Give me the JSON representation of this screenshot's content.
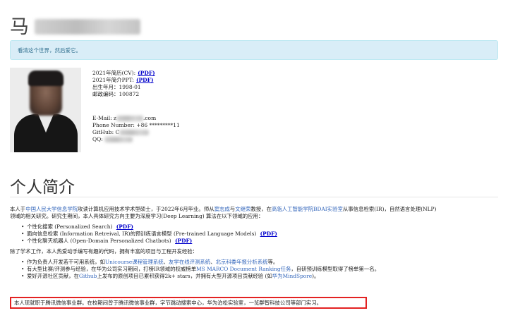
{
  "header": {
    "name_visible": "马"
  },
  "motto": "看清这个世界，然后爱它。",
  "profile": {
    "cv_label": "2021年简历(CV):",
    "ppt_label": "2021年简介PPT:",
    "pdf_label": "(PDF)",
    "birth_label": "出生年月：",
    "birth_value": "1998-01",
    "postal_label": "邮政编码：",
    "postal_value": "100872",
    "email_label": "E-Mail:",
    "email_prefix": "z",
    "email_suffix": ".com",
    "phone_label": "Phone Number:",
    "phone_value": "+86 *********11",
    "github_label": "GitHub:",
    "github_prefix": "C",
    "qq_label": "QQ:"
  },
  "section": {
    "title": "个人简介"
  },
  "intro": {
    "t1": "本人于",
    "l1": "中国人民大学信息学院",
    "t2": "攻读计算机应用技术学术型硕士，于2022年6月毕业。师从",
    "l2": "窦志成",
    "t3": "与",
    "l3": "文继荣",
    "t4": "教授，在",
    "l4": "高瓴人工智能学院BDAI实验室",
    "t5": "从事信息检索(IR)，自然语言处理(NLP)",
    "line2": "领域的相关研究。研究生期间，本人具体研究方向主要为深度学习(Deep Learning) 算法在以下领域的应用："
  },
  "research": [
    {
      "text": "个性化搜索 (Personalized Search)",
      "pdf": "(PDF)"
    },
    {
      "text": "面向信息检索 (Information Retreival, IR)的预训练语言模型 (Pre-trained Language Models)",
      "pdf": "(PDF)"
    },
    {
      "text": "个性化聊天机器人 (Open-Domain Personalized Chatbots)",
      "pdf": "(PDF)"
    }
  ],
  "projects": {
    "intro": "除了学术工作，本人热爱动手编写有趣的代码，拥有丰富的项目与工程开发经验：",
    "b1_t1": "作为负责人开发若干可用系统，如",
    "b1_l1": "Unicourse课程管理系统",
    "b1_t2": "、",
    "b1_l2": "友学在线评测系统",
    "b1_t3": "、",
    "b1_l3": "北京科委年报分析系统",
    "b1_t4": "等。",
    "b2_t1": "有大型比赛/评测参与经验，在华为公司实习期间，打榜IR领域的权威榜单",
    "b2_l1": "MS MARCO Document Ranking任务",
    "b2_t2": "，自研预训练模型取得了榜单第一名。",
    "b3_t1": "爱好开源社区贡献，在",
    "b3_l1": "Github",
    "b3_t2": "上发布的原创项目已累积获得2k+ stars，并拥有大型开源项目贡献经验 (如",
    "b3_l2": "华为MindSpore",
    "b3_t3": ")。"
  },
  "highlight": "本人现就职于腾讯微信事业群。在校期间曾于腾讯微信事业群，字节跳动搜索中心，华为泊松实验室，一览群智科技公司等部门实习。"
}
